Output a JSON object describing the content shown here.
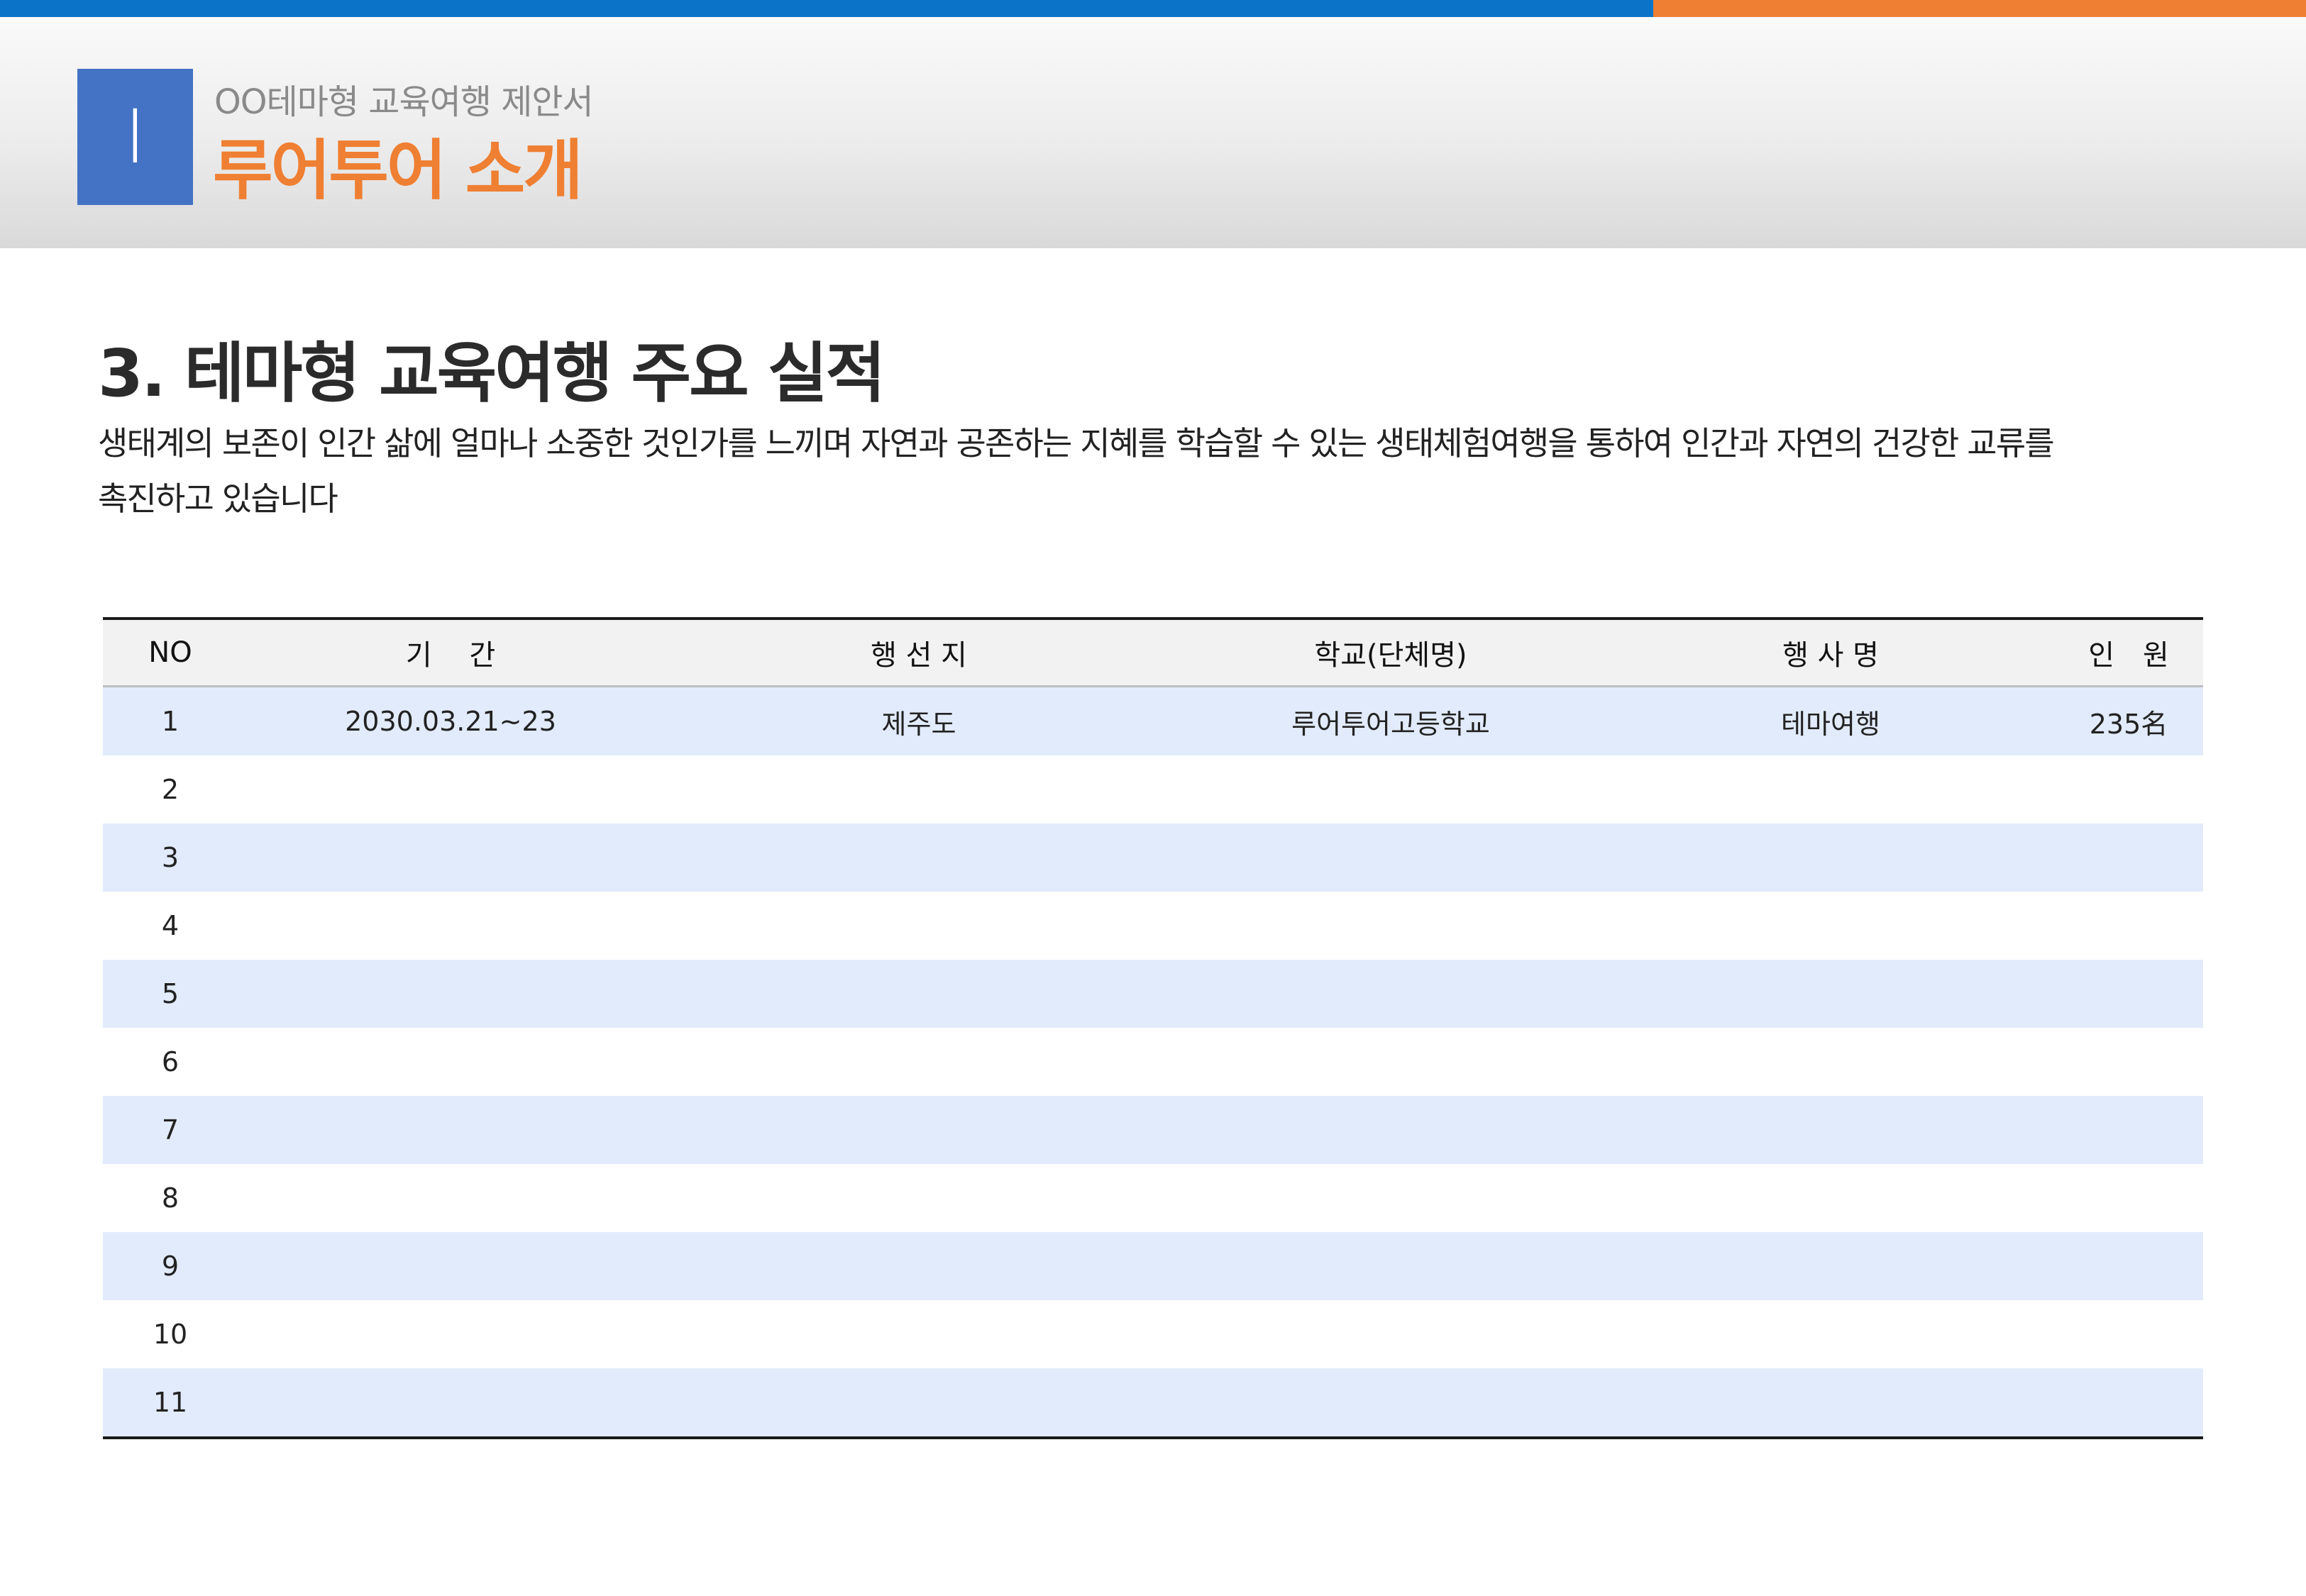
{
  "header": {
    "chapter_numeral": "I",
    "subtitle": "OO테마형 교육여행 제안서",
    "title": "루어투어 소개"
  },
  "section": {
    "title": "3. 테마형 교육여행 주요 실적",
    "description_line1": "생태계의 보존이 인간 삶에 얼마나 소중한 것인가를 느끼며 자연과 공존하는 지혜를 학습할 수 있는 생태체험여행을  통하여 인간과 자연의 건강한 교류를",
    "description_line2": "촉진하고 있습니다"
  },
  "table": {
    "headers": {
      "no": "NO",
      "period": "기　 간",
      "destination": "행 선 지",
      "school": "학교(단체명)",
      "event": "행 사 명",
      "people": "인　원"
    },
    "rows": [
      {
        "no": "1",
        "period": "2030.03.21~23",
        "destination": "제주도",
        "school": "루어투어고등학교",
        "event": "테마여행",
        "people": "235名"
      },
      {
        "no": "2",
        "period": "",
        "destination": "",
        "school": "",
        "event": "",
        "people": ""
      },
      {
        "no": "3",
        "period": "",
        "destination": "",
        "school": "",
        "event": "",
        "people": ""
      },
      {
        "no": "4",
        "period": "",
        "destination": "",
        "school": "",
        "event": "",
        "people": ""
      },
      {
        "no": "5",
        "period": "",
        "destination": "",
        "school": "",
        "event": "",
        "people": ""
      },
      {
        "no": "6",
        "period": "",
        "destination": "",
        "school": "",
        "event": "",
        "people": ""
      },
      {
        "no": "7",
        "period": "",
        "destination": "",
        "school": "",
        "event": "",
        "people": ""
      },
      {
        "no": "8",
        "period": "",
        "destination": "",
        "school": "",
        "event": "",
        "people": ""
      },
      {
        "no": "9",
        "period": "",
        "destination": "",
        "school": "",
        "event": "",
        "people": ""
      },
      {
        "no": "10",
        "period": "",
        "destination": "",
        "school": "",
        "event": "",
        "people": ""
      },
      {
        "no": "11",
        "period": "",
        "destination": "",
        "school": "",
        "event": "",
        "people": ""
      }
    ]
  },
  "colors": {
    "top_bar_blue": "#0c74c8",
    "top_bar_orange": "#ef7f32",
    "chapter_box": "#4472c4",
    "title_orange": "#ef7f32",
    "row_stripe": "#e1ebfb"
  }
}
